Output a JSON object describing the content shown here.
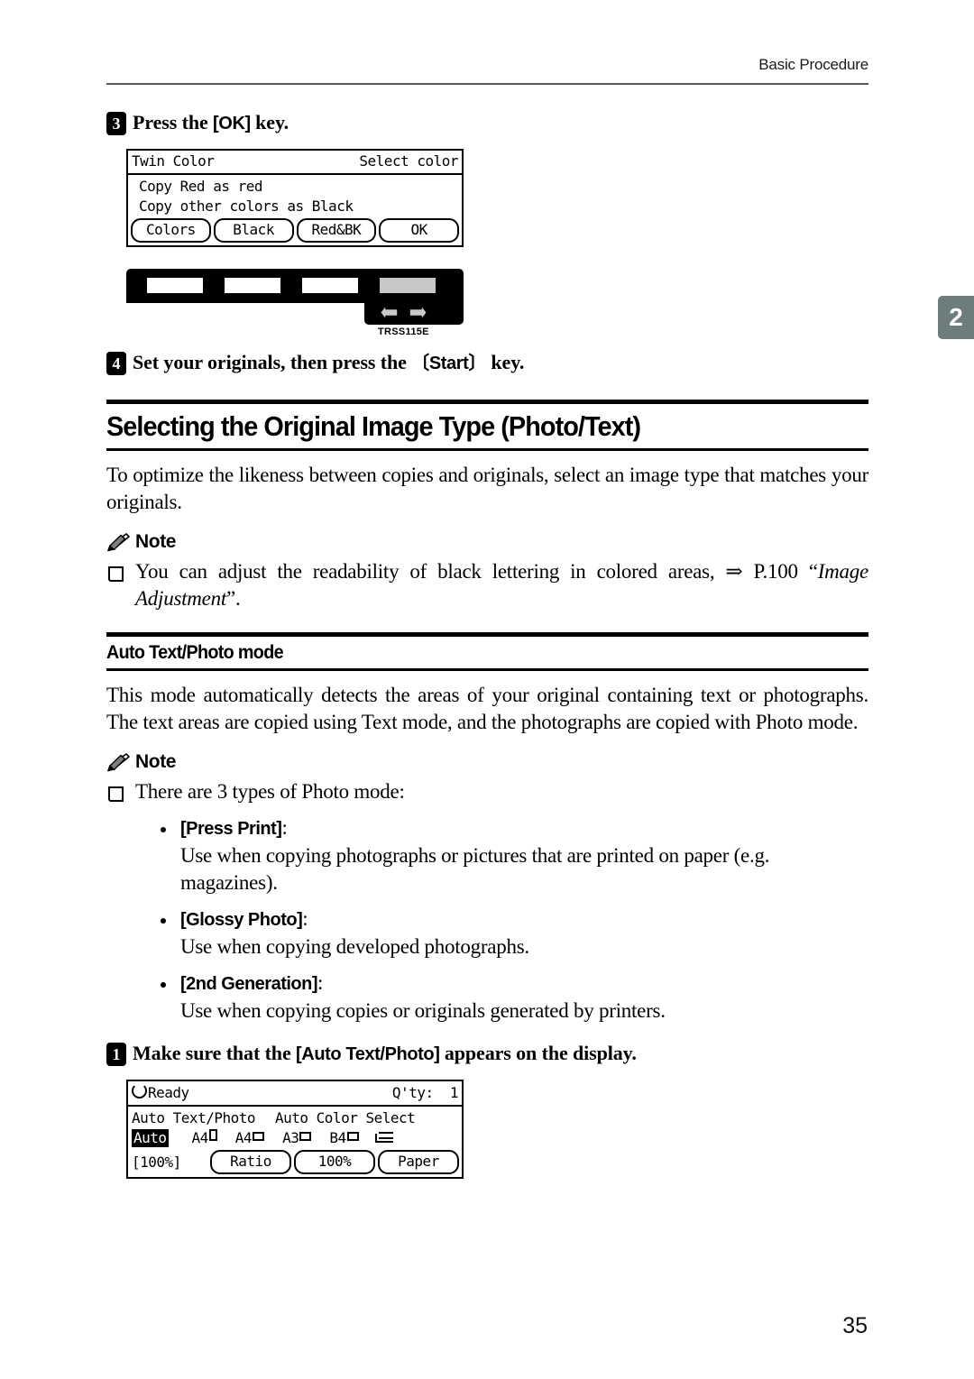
{
  "header": {
    "running_head": "Basic Procedure"
  },
  "chapter_tab": {
    "number": "2",
    "color": "#6d7c7c"
  },
  "page_number": "35",
  "steps": {
    "step3": {
      "number": "3",
      "text_before": "Press the [OK] key.",
      "label": "Press the",
      "key": "[OK]",
      "label_after": "key."
    },
    "step4": {
      "number": "4",
      "label": "Set your originals, then press the",
      "key": "Start",
      "label_after": "key."
    },
    "step1": {
      "number": "1",
      "label": "Make sure that the",
      "key": "[Auto Text/Photo]",
      "label_after": "appears on the display."
    }
  },
  "lcd_twin_color": {
    "title": "Twin Color",
    "title_right": "Select color",
    "line1": "Copy Red as red",
    "line2": "Copy other colors as Black",
    "softkeys": [
      "Colors",
      "Black",
      "Red&BK",
      "OK"
    ]
  },
  "operation_panel": {
    "caption": "TRSS115E",
    "keys": [
      "key-1",
      "key-2",
      "key-3",
      "key-4-selected"
    ],
    "arrows": [
      "left-arrow",
      "right-arrow"
    ],
    "highlight_color": "#c8c8c8"
  },
  "section": {
    "title": "Selecting the Original Image Type (Photo/Text)",
    "intro": "To optimize the likeness between copies and originals, select an image type that matches your originals."
  },
  "note1": {
    "label": "Note",
    "item_pre": "You can adjust the readability of black lettering in colored areas, ",
    "item_arrow": "⇒",
    "item_ref": " P.100 ",
    "item_quote_open": "“",
    "item_title": "Image Adjustment",
    "item_quote_close": "”."
  },
  "subsection": {
    "title": "Auto Text/Photo mode",
    "body": "This mode automatically detects the areas of your original containing text or photographs. The text areas are copied using Text mode, and the photographs are copied with Photo mode."
  },
  "note2": {
    "label": "Note",
    "lead": "There are 3 types of Photo mode:",
    "bullets": [
      {
        "term": "[Press Print]",
        "colon": ":",
        "desc": "Use when copying photographs or pictures that are printed on paper (e.g. magazines)."
      },
      {
        "term": "[Glossy Photo]",
        "colon": ":",
        "desc": "Use when copying developed photographs."
      },
      {
        "term": "[2nd Generation]",
        "colon": ":",
        "desc": "Use when copying copies or originals generated by printers."
      }
    ]
  },
  "lcd_ready": {
    "status": "Ready",
    "qty_label": "Q'ty:",
    "qty_value": "1",
    "mode_image": "Auto Text/Photo",
    "mode_color": "Auto Color Select",
    "paper_auto": "Auto",
    "paper_sizes": [
      "A4",
      "A4",
      "A3",
      "B4"
    ],
    "zoom_display": "[100%]",
    "softkeys": [
      "Ratio",
      "100%",
      "Paper"
    ]
  }
}
